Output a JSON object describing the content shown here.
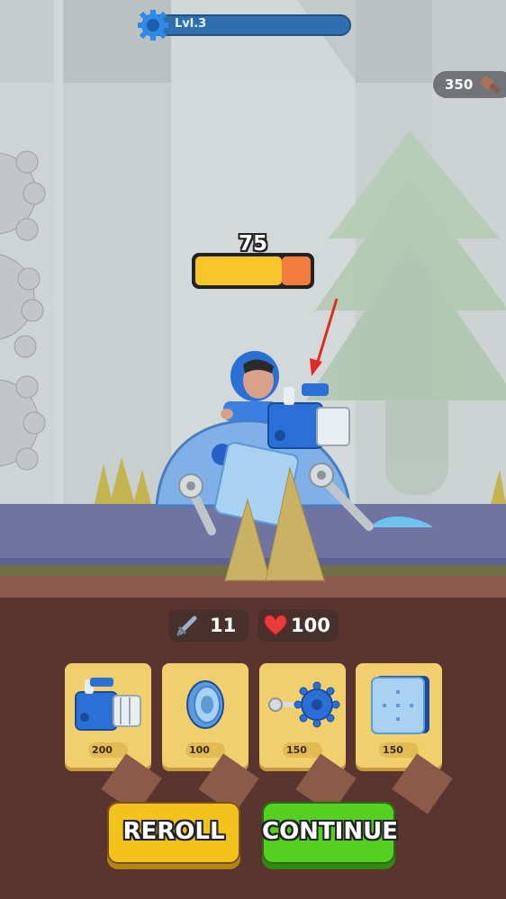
{
  "level": {
    "label": "Lvl.3",
    "progress": 0.0,
    "icon": "gear-icon"
  },
  "currency": {
    "amount": "350",
    "icon": "bolt-icon"
  },
  "health_bar": {
    "value": "75",
    "fill": 0.75,
    "colors": {
      "fill": "#f5c52a",
      "lost": "#f27b3f"
    }
  },
  "stats": {
    "attack": {
      "value": "11",
      "icon": "sword-icon"
    },
    "health": {
      "value": "100",
      "icon": "heart-icon"
    }
  },
  "shop": {
    "cards": [
      {
        "item": "cannon",
        "price": "200",
        "icon": "cannon-icon"
      },
      {
        "item": "wheel",
        "price": "100",
        "icon": "wheel-icon"
      },
      {
        "item": "spiked-mace",
        "price": "150",
        "icon": "mace-icon"
      },
      {
        "item": "armor-plate",
        "price": "150",
        "icon": "armor-plate-icon"
      }
    ]
  },
  "buttons": {
    "reroll": "REROLL",
    "continue": "CONTINUE"
  },
  "colors": {
    "panel": "#5a3530",
    "reroll": "#f4c21c",
    "continue": "#55d020",
    "road": "#7173a1"
  }
}
